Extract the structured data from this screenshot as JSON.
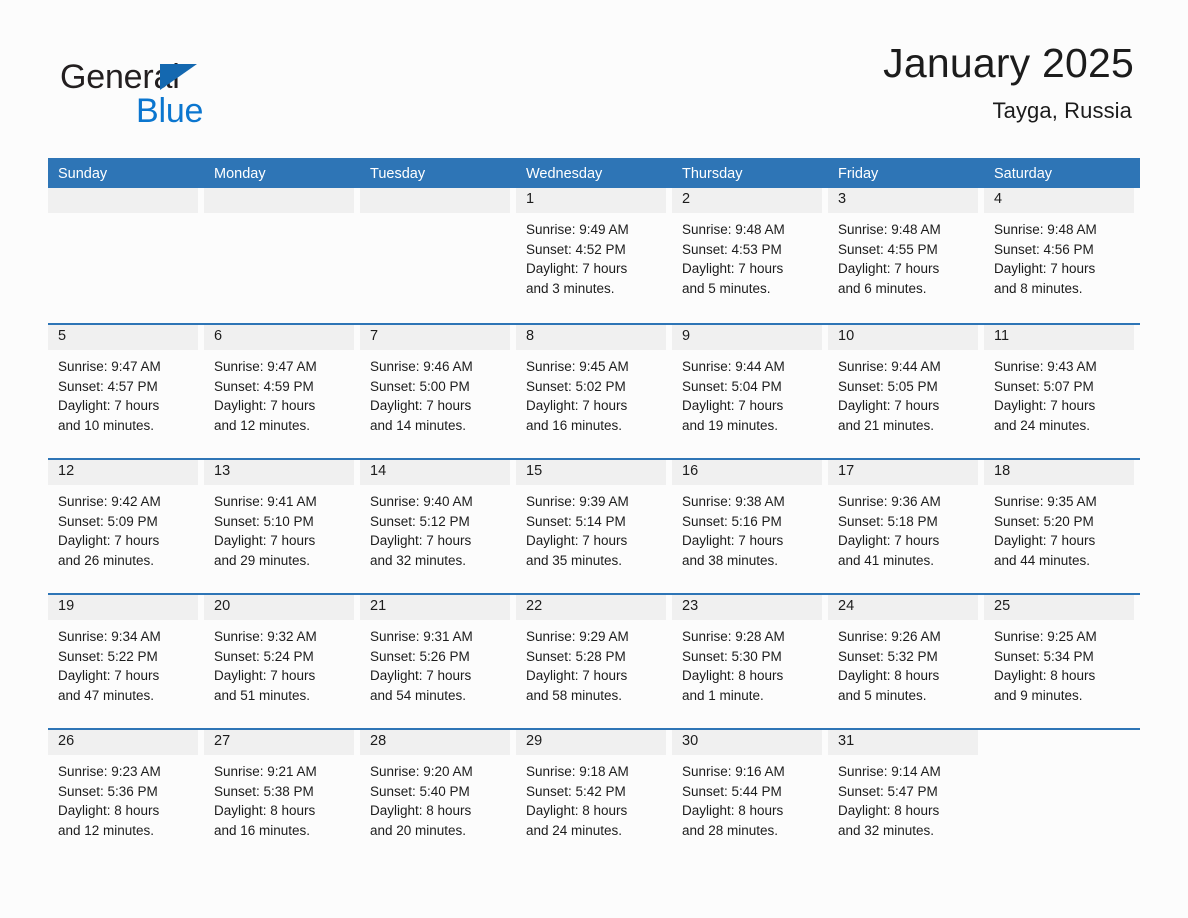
{
  "brand": {
    "name_part1": "General",
    "name_part2": "Blue",
    "triangle_icon": "triangle-icon",
    "accent_color": "#0b76cf",
    "header_color": "#2e75b6"
  },
  "header": {
    "title": "January 2025",
    "subtitle": "Tayga, Russia"
  },
  "calendar": {
    "weekdays": [
      "Sunday",
      "Monday",
      "Tuesday",
      "Wednesday",
      "Thursday",
      "Friday",
      "Saturday"
    ],
    "labels": {
      "sunrise": "Sunrise:",
      "sunset": "Sunset:",
      "daylight": "Daylight:"
    },
    "weeks": [
      [
        {
          "date": "",
          "empty": true
        },
        {
          "date": "",
          "empty": true
        },
        {
          "date": "",
          "empty": true
        },
        {
          "date": "1",
          "sunrise": "Sunrise: 9:49 AM",
          "sunset": "Sunset: 4:52 PM",
          "daylight1": "Daylight: 7 hours",
          "daylight2": "and 3 minutes."
        },
        {
          "date": "2",
          "sunrise": "Sunrise: 9:48 AM",
          "sunset": "Sunset: 4:53 PM",
          "daylight1": "Daylight: 7 hours",
          "daylight2": "and 5 minutes."
        },
        {
          "date": "3",
          "sunrise": "Sunrise: 9:48 AM",
          "sunset": "Sunset: 4:55 PM",
          "daylight1": "Daylight: 7 hours",
          "daylight2": "and 6 minutes."
        },
        {
          "date": "4",
          "sunrise": "Sunrise: 9:48 AM",
          "sunset": "Sunset: 4:56 PM",
          "daylight1": "Daylight: 7 hours",
          "daylight2": "and 8 minutes."
        }
      ],
      [
        {
          "date": "5",
          "sunrise": "Sunrise: 9:47 AM",
          "sunset": "Sunset: 4:57 PM",
          "daylight1": "Daylight: 7 hours",
          "daylight2": "and 10 minutes."
        },
        {
          "date": "6",
          "sunrise": "Sunrise: 9:47 AM",
          "sunset": "Sunset: 4:59 PM",
          "daylight1": "Daylight: 7 hours",
          "daylight2": "and 12 minutes."
        },
        {
          "date": "7",
          "sunrise": "Sunrise: 9:46 AM",
          "sunset": "Sunset: 5:00 PM",
          "daylight1": "Daylight: 7 hours",
          "daylight2": "and 14 minutes."
        },
        {
          "date": "8",
          "sunrise": "Sunrise: 9:45 AM",
          "sunset": "Sunset: 5:02 PM",
          "daylight1": "Daylight: 7 hours",
          "daylight2": "and 16 minutes."
        },
        {
          "date": "9",
          "sunrise": "Sunrise: 9:44 AM",
          "sunset": "Sunset: 5:04 PM",
          "daylight1": "Daylight: 7 hours",
          "daylight2": "and 19 minutes."
        },
        {
          "date": "10",
          "sunrise": "Sunrise: 9:44 AM",
          "sunset": "Sunset: 5:05 PM",
          "daylight1": "Daylight: 7 hours",
          "daylight2": "and 21 minutes."
        },
        {
          "date": "11",
          "sunrise": "Sunrise: 9:43 AM",
          "sunset": "Sunset: 5:07 PM",
          "daylight1": "Daylight: 7 hours",
          "daylight2": "and 24 minutes."
        }
      ],
      [
        {
          "date": "12",
          "sunrise": "Sunrise: 9:42 AM",
          "sunset": "Sunset: 5:09 PM",
          "daylight1": "Daylight: 7 hours",
          "daylight2": "and 26 minutes."
        },
        {
          "date": "13",
          "sunrise": "Sunrise: 9:41 AM",
          "sunset": "Sunset: 5:10 PM",
          "daylight1": "Daylight: 7 hours",
          "daylight2": "and 29 minutes."
        },
        {
          "date": "14",
          "sunrise": "Sunrise: 9:40 AM",
          "sunset": "Sunset: 5:12 PM",
          "daylight1": "Daylight: 7 hours",
          "daylight2": "and 32 minutes."
        },
        {
          "date": "15",
          "sunrise": "Sunrise: 9:39 AM",
          "sunset": "Sunset: 5:14 PM",
          "daylight1": "Daylight: 7 hours",
          "daylight2": "and 35 minutes."
        },
        {
          "date": "16",
          "sunrise": "Sunrise: 9:38 AM",
          "sunset": "Sunset: 5:16 PM",
          "daylight1": "Daylight: 7 hours",
          "daylight2": "and 38 minutes."
        },
        {
          "date": "17",
          "sunrise": "Sunrise: 9:36 AM",
          "sunset": "Sunset: 5:18 PM",
          "daylight1": "Daylight: 7 hours",
          "daylight2": "and 41 minutes."
        },
        {
          "date": "18",
          "sunrise": "Sunrise: 9:35 AM",
          "sunset": "Sunset: 5:20 PM",
          "daylight1": "Daylight: 7 hours",
          "daylight2": "and 44 minutes."
        }
      ],
      [
        {
          "date": "19",
          "sunrise": "Sunrise: 9:34 AM",
          "sunset": "Sunset: 5:22 PM",
          "daylight1": "Daylight: 7 hours",
          "daylight2": "and 47 minutes."
        },
        {
          "date": "20",
          "sunrise": "Sunrise: 9:32 AM",
          "sunset": "Sunset: 5:24 PM",
          "daylight1": "Daylight: 7 hours",
          "daylight2": "and 51 minutes."
        },
        {
          "date": "21",
          "sunrise": "Sunrise: 9:31 AM",
          "sunset": "Sunset: 5:26 PM",
          "daylight1": "Daylight: 7 hours",
          "daylight2": "and 54 minutes."
        },
        {
          "date": "22",
          "sunrise": "Sunrise: 9:29 AM",
          "sunset": "Sunset: 5:28 PM",
          "daylight1": "Daylight: 7 hours",
          "daylight2": "and 58 minutes."
        },
        {
          "date": "23",
          "sunrise": "Sunrise: 9:28 AM",
          "sunset": "Sunset: 5:30 PM",
          "daylight1": "Daylight: 8 hours",
          "daylight2": "and 1 minute."
        },
        {
          "date": "24",
          "sunrise": "Sunrise: 9:26 AM",
          "sunset": "Sunset: 5:32 PM",
          "daylight1": "Daylight: 8 hours",
          "daylight2": "and 5 minutes."
        },
        {
          "date": "25",
          "sunrise": "Sunrise: 9:25 AM",
          "sunset": "Sunset: 5:34 PM",
          "daylight1": "Daylight: 8 hours",
          "daylight2": "and 9 minutes."
        }
      ],
      [
        {
          "date": "26",
          "sunrise": "Sunrise: 9:23 AM",
          "sunset": "Sunset: 5:36 PM",
          "daylight1": "Daylight: 8 hours",
          "daylight2": "and 12 minutes."
        },
        {
          "date": "27",
          "sunrise": "Sunrise: 9:21 AM",
          "sunset": "Sunset: 5:38 PM",
          "daylight1": "Daylight: 8 hours",
          "daylight2": "and 16 minutes."
        },
        {
          "date": "28",
          "sunrise": "Sunrise: 9:20 AM",
          "sunset": "Sunset: 5:40 PM",
          "daylight1": "Daylight: 8 hours",
          "daylight2": "and 20 minutes."
        },
        {
          "date": "29",
          "sunrise": "Sunrise: 9:18 AM",
          "sunset": "Sunset: 5:42 PM",
          "daylight1": "Daylight: 8 hours",
          "daylight2": "and 24 minutes."
        },
        {
          "date": "30",
          "sunrise": "Sunrise: 9:16 AM",
          "sunset": "Sunset: 5:44 PM",
          "daylight1": "Daylight: 8 hours",
          "daylight2": "and 28 minutes."
        },
        {
          "date": "31",
          "sunrise": "Sunrise: 9:14 AM",
          "sunset": "Sunset: 5:47 PM",
          "daylight1": "Daylight: 8 hours",
          "daylight2": "and 32 minutes."
        },
        {
          "date": "",
          "empty": true,
          "blank": true
        }
      ]
    ]
  }
}
